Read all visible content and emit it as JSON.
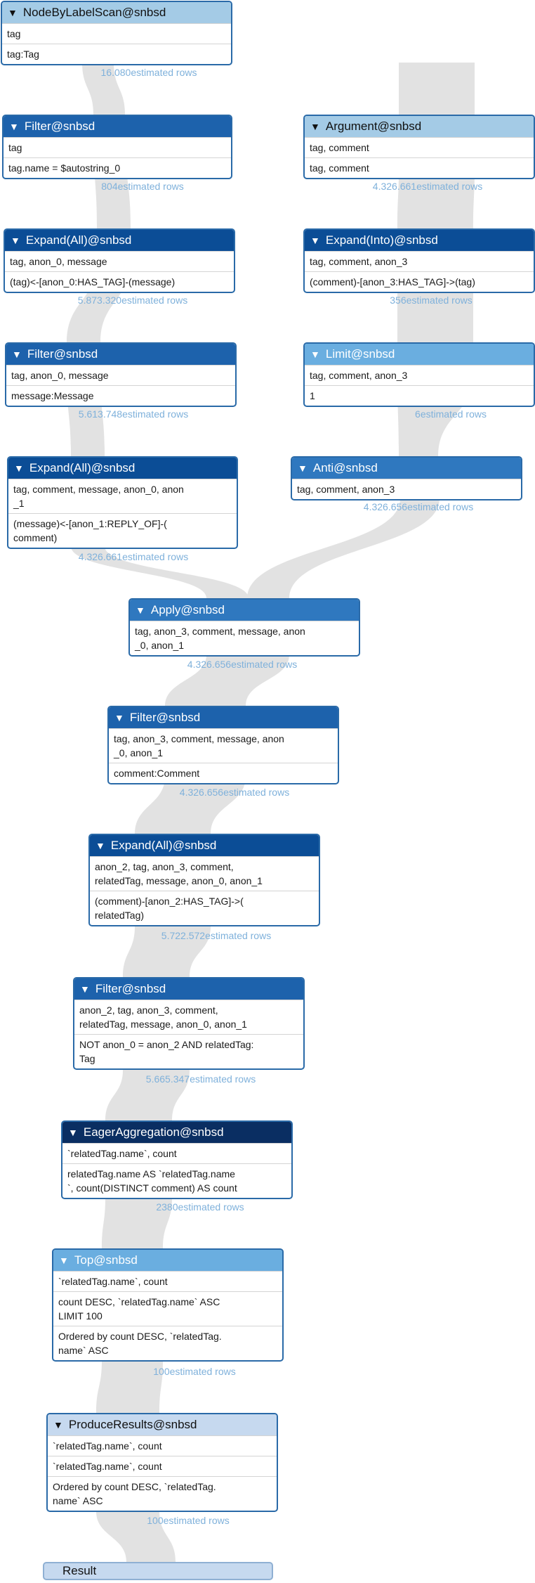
{
  "colors": {
    "flow": "#e2e2e2",
    "estimate_text": "#7fb1db",
    "level1": "#a4cbe6",
    "level2": "#6aaee0",
    "level3": "#2f78bf",
    "level4": "#1d62ac",
    "level5": "#0b4d96",
    "level6": "#0a2e62",
    "result_fill": "#c6d9ef"
  },
  "nodes": [
    {
      "id": "n1",
      "title": "NodeByLabelScan@snbsd",
      "header_color": "#a4cbe6",
      "dark_text": true,
      "rows": [
        "tag",
        "tag:Tag"
      ],
      "estimate": "16.080estimated rows"
    },
    {
      "id": "n2",
      "title": "Filter@snbsd",
      "header_color": "#1d62ac",
      "rows": [
        "tag",
        "tag.name = $autostring_0"
      ],
      "estimate": "804estimated rows"
    },
    {
      "id": "n3",
      "title": "Expand(All)@snbsd",
      "header_color": "#0b4d96",
      "rows": [
        "tag, anon_0, message",
        "(tag)<-[anon_0:HAS_TAG]-(message)"
      ],
      "estimate": "5.873.320estimated rows"
    },
    {
      "id": "n4",
      "title": "Filter@snbsd",
      "header_color": "#1d62ac",
      "rows": [
        "tag, anon_0, message",
        "message:Message"
      ],
      "estimate": "5.613.748estimated rows"
    },
    {
      "id": "n5",
      "title": "Expand(All)@snbsd",
      "header_color": "#0b4d96",
      "rows": [
        "tag, comment, message, anon_0, anon\n_1",
        "(message)<-[anon_1:REPLY_OF]-(\ncomment)"
      ],
      "estimate": "4.326.661estimated rows"
    },
    {
      "id": "r1",
      "title": "Argument@snbsd",
      "header_color": "#a4cbe6",
      "dark_text": true,
      "rows": [
        "tag, comment",
        "tag, comment"
      ],
      "estimate": "4.326.661estimated rows"
    },
    {
      "id": "r2",
      "title": "Expand(Into)@snbsd",
      "header_color": "#0b4d96",
      "rows": [
        "tag, comment, anon_3",
        "(comment)-[anon_3:HAS_TAG]->(tag)"
      ],
      "estimate": "356estimated rows"
    },
    {
      "id": "r3",
      "title": "Limit@snbsd",
      "header_color": "#6aaee0",
      "rows": [
        "tag, comment, anon_3",
        "1"
      ],
      "estimate": "6estimated rows"
    },
    {
      "id": "r4",
      "title": "Anti@snbsd",
      "header_color": "#2f78bf",
      "rows": [
        "tag, comment, anon_3"
      ],
      "estimate": "4.326.656estimated rows"
    },
    {
      "id": "n6",
      "title": "Apply@snbsd",
      "header_color": "#2f78bf",
      "rows": [
        "tag, anon_3, comment, message, anon\n_0, anon_1"
      ],
      "estimate": "4.326.656estimated rows"
    },
    {
      "id": "n7",
      "title": "Filter@snbsd",
      "header_color": "#1d62ac",
      "rows": [
        "tag, anon_3, comment, message, anon\n_0, anon_1",
        "comment:Comment"
      ],
      "estimate": "4.326.656estimated rows"
    },
    {
      "id": "n8",
      "title": "Expand(All)@snbsd",
      "header_color": "#0b4d96",
      "rows": [
        "anon_2, tag, anon_3, comment,\nrelatedTag, message, anon_0, anon_1",
        "(comment)-[anon_2:HAS_TAG]->(\nrelatedTag)"
      ],
      "estimate": "5.722.572estimated rows"
    },
    {
      "id": "n9",
      "title": "Filter@snbsd",
      "header_color": "#1d62ac",
      "rows": [
        "anon_2, tag, anon_3, comment,\nrelatedTag, message, anon_0, anon_1",
        "NOT anon_0 = anon_2 AND relatedTag:\nTag"
      ],
      "estimate": "5.665.347estimated rows"
    },
    {
      "id": "n10",
      "title": "EagerAggregation@snbsd",
      "header_color": "#0a2e62",
      "rows": [
        "`relatedTag.name`, count",
        "relatedTag.name AS `relatedTag.name\n`, count(DISTINCT comment) AS count"
      ],
      "estimate": "2380estimated rows"
    },
    {
      "id": "n11",
      "title": "Top@snbsd",
      "header_color": "#6aaee0",
      "rows": [
        "`relatedTag.name`, count",
        "count DESC, `relatedTag.name` ASC\nLIMIT 100",
        "Ordered by count DESC, `relatedTag.\nname` ASC"
      ],
      "estimate": "100estimated rows"
    },
    {
      "id": "n12",
      "title": "ProduceResults@snbsd",
      "header_color": "#c6d9ef",
      "dark_text": true,
      "rows": [
        "`relatedTag.name`, count",
        "`relatedTag.name`, count",
        "Ordered by count DESC, `relatedTag.\nname` ASC"
      ],
      "estimate": "100estimated rows"
    }
  ],
  "result_label": "Result"
}
